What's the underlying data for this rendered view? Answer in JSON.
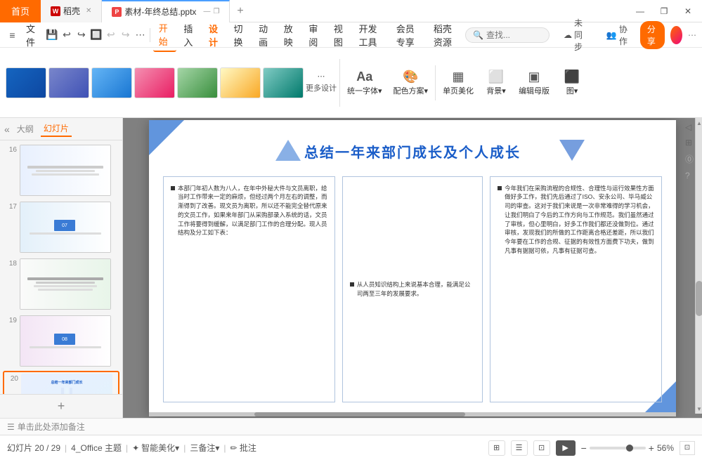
{
  "titleBar": {
    "homeTab": "首页",
    "tabs": [
      {
        "id": "wps",
        "icon": "W",
        "label": "稻壳",
        "iconColor": "#c00"
      },
      {
        "id": "pptx",
        "icon": "P",
        "label": "素材-年终总结.pptx",
        "iconColor": "#e44"
      }
    ],
    "addTab": "+",
    "windowControls": [
      "—",
      "❐",
      "✕"
    ]
  },
  "menuBar": {
    "fileIcon": "≡",
    "fileLabel": "文件",
    "icons": [
      "💾",
      "↩",
      "↪",
      "🔲",
      "↩",
      "↪",
      "⋯"
    ],
    "tabs": [
      "开始",
      "插入",
      "设计",
      "切换",
      "动画",
      "放映",
      "审阅",
      "视图",
      "开发工具",
      "会员专享",
      "稻壳资源"
    ],
    "search": {
      "placeholder": "查找..."
    },
    "rightActions": [
      "未同步",
      "协作",
      "分享"
    ],
    "avatar": true
  },
  "ribbon": {
    "themes": [
      {
        "id": 1,
        "label": ""
      },
      {
        "id": 2,
        "label": ""
      },
      {
        "id": 3,
        "label": ""
      },
      {
        "id": 4,
        "label": ""
      },
      {
        "id": 5,
        "label": ""
      },
      {
        "id": 6,
        "label": ""
      },
      {
        "id": 7,
        "label": ""
      }
    ],
    "moreDesigns": "更多设计",
    "buttons": [
      {
        "id": "font",
        "label": "统一字体▾",
        "icon": "Aa"
      },
      {
        "id": "color",
        "label": "配色方案▾",
        "icon": "🎨"
      },
      {
        "id": "beautify",
        "label": "单页美化",
        "icon": "▦"
      },
      {
        "id": "bg",
        "label": "背景▾",
        "icon": "⬜"
      },
      {
        "id": "master",
        "label": "编辑母版",
        "icon": "▣"
      },
      {
        "id": "size",
        "label": "图▾",
        "icon": "⬛"
      }
    ]
  },
  "slidePanel": {
    "outlineLabel": "大纲",
    "slideLabel": "幻灯片",
    "slides": [
      {
        "num": "16",
        "active": false
      },
      {
        "num": "17",
        "active": false
      },
      {
        "num": "18",
        "active": false
      },
      {
        "num": "19",
        "active": false
      },
      {
        "num": "20",
        "active": true
      }
    ],
    "addLabel": "+"
  },
  "canvas": {
    "slide": {
      "title": "总结一年来部门成长及个人成长",
      "col1": {
        "text": "本部门年初人数为八人，在年中外秘大件与文员离职，给当时工作带来一定的麻烦，但经过两个月左右的调整，而渐得到了改善。现文员为离职，所以还不能完全替代原来的文员工作，如果来年部门从采购部录入系统的话，文员工作将要得到缓解，以满足部门工作的合理分配。现人员结构及分工如下表："
      },
      "col2": {
        "text": "从人员知识结构上来说基本合理，能满足公司两至三年的发展要求。"
      },
      "col3": {
        "text": "今年我们在采购流程的合规性、合理性与运行效果性方面做好多工作，我们先后通过了ISO、安永公司、毕马威公司的审查。这对于我们来说是一次非常难得的学习机会，让我们明白了今后的工作方向与工作规范。我们虽然通过了审核，但心里明白，好多工作我们都还没做到位。通过审核，发现我们的所做的工作距离合格还差距，所以我们今年要在工作的合规、征据的有效性方面费下功夫，做到凡事有据据可依，凡事有征据可查。"
      }
    }
  },
  "noteBar": {
    "icon": "☰",
    "label": "单击此处添加备注"
  },
  "statusBar": {
    "slideInfo": "幻灯片 20 / 29",
    "theme": "4_Office 主题",
    "beautifyLabel": "智能美化▾",
    "noteLabel": "三备注▾",
    "annotationLabel": "批注",
    "views": [
      "⊞",
      "☰",
      "⊡"
    ],
    "playLabel": "▶",
    "zoom": "56%",
    "zoomOut": "−",
    "zoomIn": "+"
  }
}
